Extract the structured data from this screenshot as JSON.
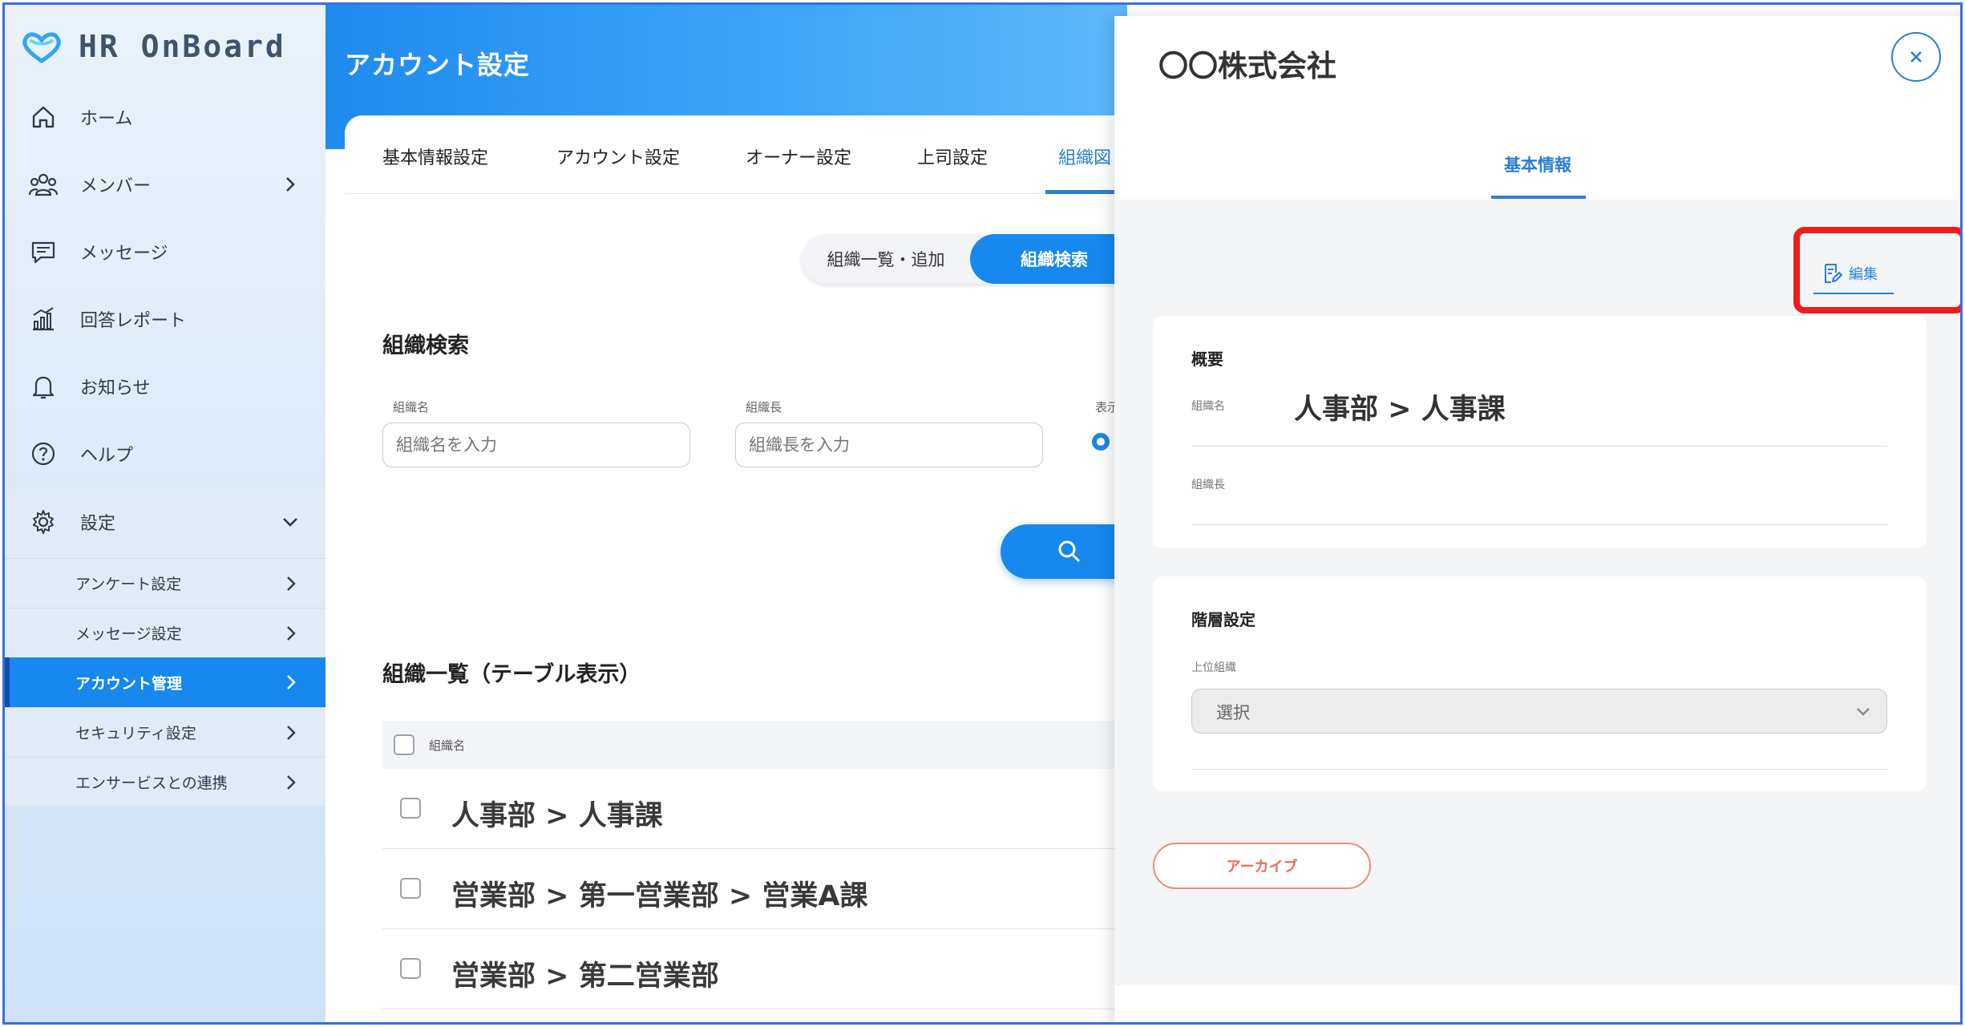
{
  "brand": {
    "name": "HR OnBoard",
    "logo_icon": "heart-loop-logo-icon"
  },
  "sidebar": {
    "items": [
      {
        "label": "ホーム",
        "icon": "home-icon"
      },
      {
        "label": "メンバー",
        "icon": "members-icon",
        "has_chevron": true
      },
      {
        "label": "メッセージ",
        "icon": "message-icon"
      },
      {
        "label": "回答レポート",
        "icon": "report-chart-icon"
      },
      {
        "label": "お知らせ",
        "icon": "bell-icon"
      },
      {
        "label": "ヘルプ",
        "icon": "help-icon"
      },
      {
        "label": "設定",
        "icon": "gear-icon",
        "expanded": true
      }
    ],
    "sub_items": [
      {
        "label": "アンケート設定"
      },
      {
        "label": "メッセージ設定"
      },
      {
        "label": "アカウント管理",
        "active": true
      },
      {
        "label": "セキュリティ設定"
      },
      {
        "label": "エンサービスとの連携"
      }
    ]
  },
  "main": {
    "title": "アカウント設定",
    "tabs": [
      {
        "label": "基本情報設定"
      },
      {
        "label": "アカウント設定"
      },
      {
        "label": "オーナー設定"
      },
      {
        "label": "上司設定"
      },
      {
        "label": "組織図",
        "active": true
      }
    ],
    "toggle": {
      "option1": "組織一覧・追加",
      "option2": "組織検索",
      "selected": "組織検索"
    },
    "search": {
      "heading": "組織検索",
      "name_label": "組織名",
      "name_placeholder": "組織名を入力",
      "leader_label": "組織長",
      "leader_placeholder": "組織長を入力",
      "display_label": "表示",
      "button_icon": "search-icon"
    },
    "list": {
      "heading": "組織一覧（テーブル表示）",
      "column": "組織名",
      "rows": [
        {
          "name": "人事部 > 人事課"
        },
        {
          "name": "営業部 > 第一営業部 > 営業A課"
        },
        {
          "name": "営業部 > 第二営業部"
        }
      ]
    }
  },
  "drawer": {
    "title": "〇〇株式会社",
    "close_icon": "close-icon",
    "tab": "基本情報",
    "edit_label": "編集",
    "edit_icon": "edit-document-icon",
    "highlight_color": "#ee1c1c",
    "overview": {
      "heading": "概要",
      "name_label": "組織名",
      "name_value": "人事部 > 人事課",
      "leader_label": "組織長",
      "leader_value": ""
    },
    "hierarchy": {
      "heading": "階層設定",
      "parent_label": "上位組織",
      "parent_value": "選択"
    },
    "archive_label": "アーカイブ"
  },
  "colors": {
    "accent": "#1688ee",
    "brand_text": "#40536e",
    "archive": "#ee6b5a"
  }
}
